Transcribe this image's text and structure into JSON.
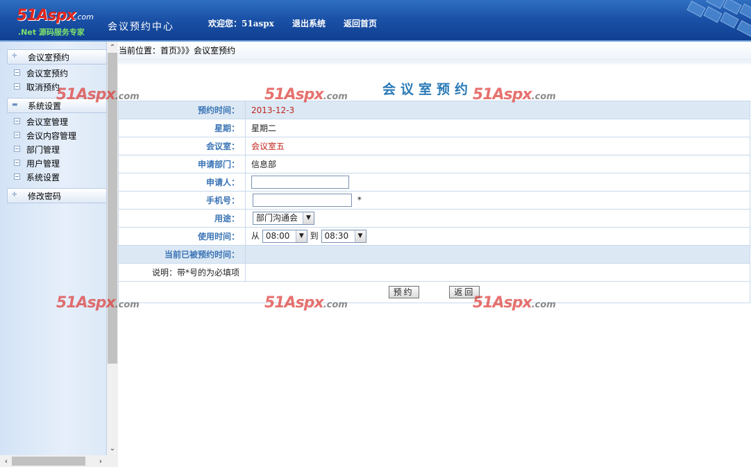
{
  "header": {
    "logo_main": "51Aspx",
    "logo_dotcom": ".com",
    "logo_sub": ".Net 源码服务专家",
    "app_title": "会议预约中心",
    "welcome_label": "欢迎您：",
    "username": "51aspx",
    "logout": "退出系统",
    "home": "返回首页"
  },
  "sidebar": {
    "sections": [
      {
        "label": "会议室预约",
        "items": [
          "会议室预约",
          "取消预约"
        ]
      },
      {
        "label": "系统设置",
        "items": [
          "会议室管理",
          "会议内容管理",
          "部门管理",
          "用户管理",
          "系统设置"
        ]
      },
      {
        "label": "修改密码",
        "items": []
      }
    ]
  },
  "breadcrumb": "当前位置：首页》》》会议室预约",
  "form": {
    "title": "会议室预约",
    "rows": {
      "date": {
        "label": "预约时间：",
        "value": "2013-12-3"
      },
      "weekday": {
        "label": "星期：",
        "value": "星期二"
      },
      "room": {
        "label": "会议室：",
        "value": "会议室五"
      },
      "dept": {
        "label": "申请部门：",
        "value": "信息部"
      },
      "applicant": {
        "label": "申请人：",
        "value": ""
      },
      "phone": {
        "label": "手机号：",
        "value": "",
        "required_mark": "*"
      },
      "purpose": {
        "label": "用途：",
        "value": "部门沟通会"
      },
      "time": {
        "label": "使用时间：",
        "from_label": "从",
        "from": "08:00",
        "to_label": "到",
        "to": "08:30"
      },
      "booked": {
        "label": "当前已被预约时间：",
        "value": ""
      },
      "note": {
        "label": "说明：带*号的为必填项",
        "value": ""
      }
    },
    "submit": "预约",
    "back": "返回"
  },
  "watermark": {
    "main": "51Aspx",
    "suffix": ".com"
  },
  "colors": {
    "header_blue": "#1b52a8",
    "label_blue": "#3a74b5",
    "value_red": "#c0241c",
    "title_blue": "#2a7ab7"
  }
}
